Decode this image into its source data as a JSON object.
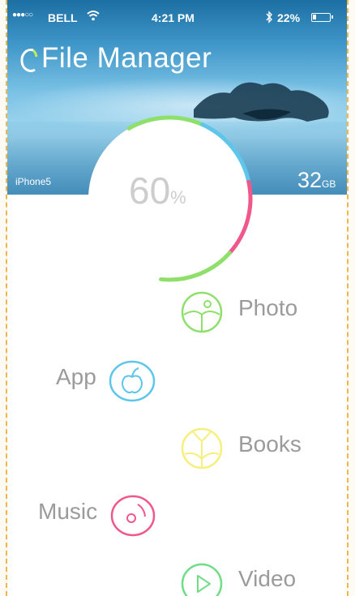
{
  "status_bar": {
    "signal": "●●●○○",
    "carrier": "BELL",
    "time": "4:21 PM",
    "battery": "22%",
    "battery_level": 0.22
  },
  "app": {
    "title": "File Manager"
  },
  "storage": {
    "device": "iPhone5",
    "capacity_value": "32",
    "capacity_unit": "GB",
    "used_value": "60",
    "used_symbol": "%",
    "used_fraction": 0.6
  },
  "categories": [
    {
      "label": "Photo",
      "icon": "photo-icon",
      "color": "#8ee06a"
    },
    {
      "label": "App",
      "icon": "apple-icon",
      "color": "#5ec6ea"
    },
    {
      "label": "Books",
      "icon": "book-icon",
      "color": "#f6ef7c"
    },
    {
      "label": "Music",
      "icon": "music-disc-icon",
      "color": "#f0588c"
    },
    {
      "label": "Video",
      "icon": "play-icon",
      "color": "#6fdc86"
    }
  ],
  "colors": {
    "ring_green": "#8ee06a",
    "ring_blue": "#5ec6ea",
    "ring_pink": "#f0588c",
    "ring_track": "#ffffff"
  }
}
